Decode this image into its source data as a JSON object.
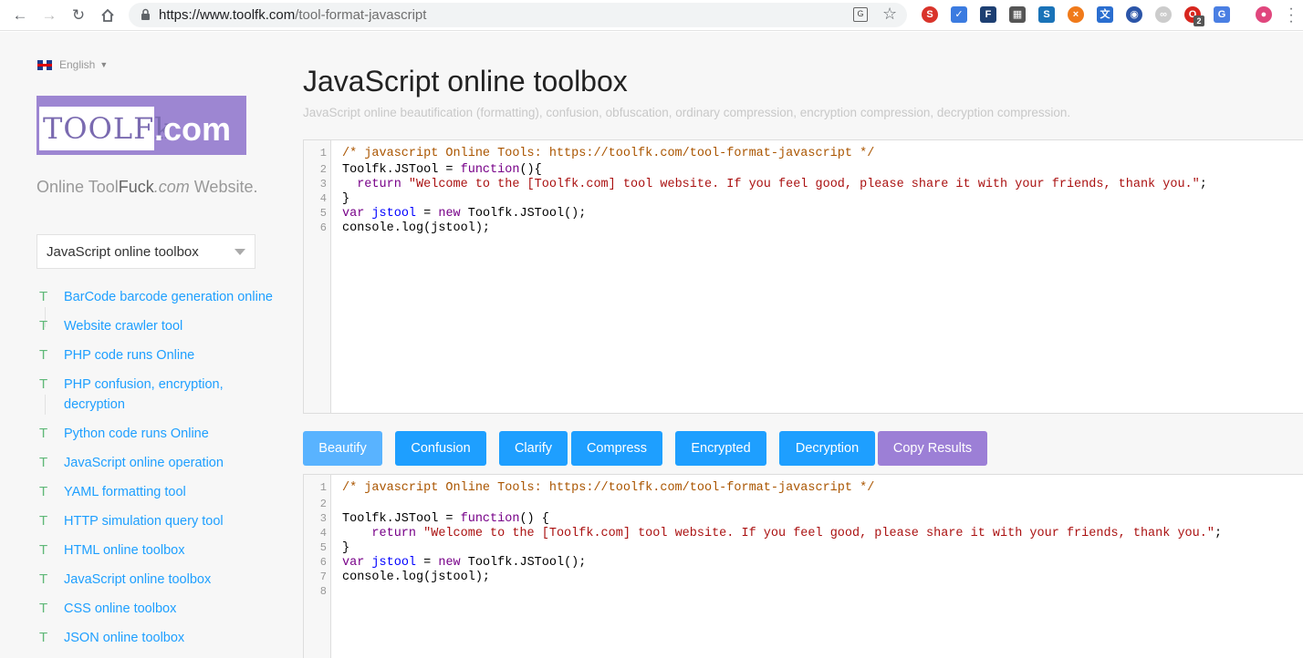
{
  "browser": {
    "url_host": "https://www.toolfk.com",
    "url_path": "/tool-format-javascript",
    "notification_count": "2"
  },
  "sidebar": {
    "language": "English",
    "logo_left": "TOOLFk",
    "logo_right": ".com",
    "tagline_parts": [
      "Online Tool",
      "Fuck",
      ".com",
      " Website."
    ],
    "selected_category": "JavaScript online toolbox",
    "tools": [
      "BarCode barcode generation online",
      "Website crawler tool",
      "PHP code runs Online",
      "PHP confusion, encryption, decryption",
      "Python code runs Online",
      "JavaScript online operation",
      "YAML formatting tool",
      "HTTP simulation query tool",
      "HTML online toolbox",
      "JavaScript online toolbox",
      "CSS online toolbox",
      "JSON online toolbox"
    ],
    "tool_marker": "T"
  },
  "main": {
    "title": "JavaScript online toolbox",
    "subtitle": "JavaScript online beautification (formatting), confusion, obfuscation, ordinary compression, encryption compression, decryption compression.",
    "input_lines": [
      "1",
      "2",
      "3",
      "4",
      "5",
      "6"
    ],
    "output_lines": [
      "1",
      "2",
      "3",
      "4",
      "5",
      "6",
      "7",
      "8"
    ],
    "buttons": {
      "beautify": "Beautify",
      "confusion": "Confusion",
      "clarify": "Clarify",
      "compress": "Compress",
      "encrypted": "Encrypted",
      "decryption": "Decryption",
      "copy": "Copy Results"
    },
    "code": {
      "comment": "/* javascript Online Tools: https://toolfk.com/tool-format-javascript */",
      "assign_a": "Toolfk.JSTool = ",
      "kw_function": "function",
      "in_fn_open": "(){",
      "out_fn_open": "() {",
      "kw_return": "return",
      "str_welcome": "\"Welcome to the [Toolfk.com] tool website. If you feel good, please share it with your friends, thank you.\"",
      "semi": ";",
      "close_brace": "}",
      "kw_var": "var",
      "def_jstool": "jstool",
      "eq": " = ",
      "kw_new": "new",
      "new_call": " Toolfk.JSTool();",
      "console": "console.log(jstool);"
    }
  }
}
